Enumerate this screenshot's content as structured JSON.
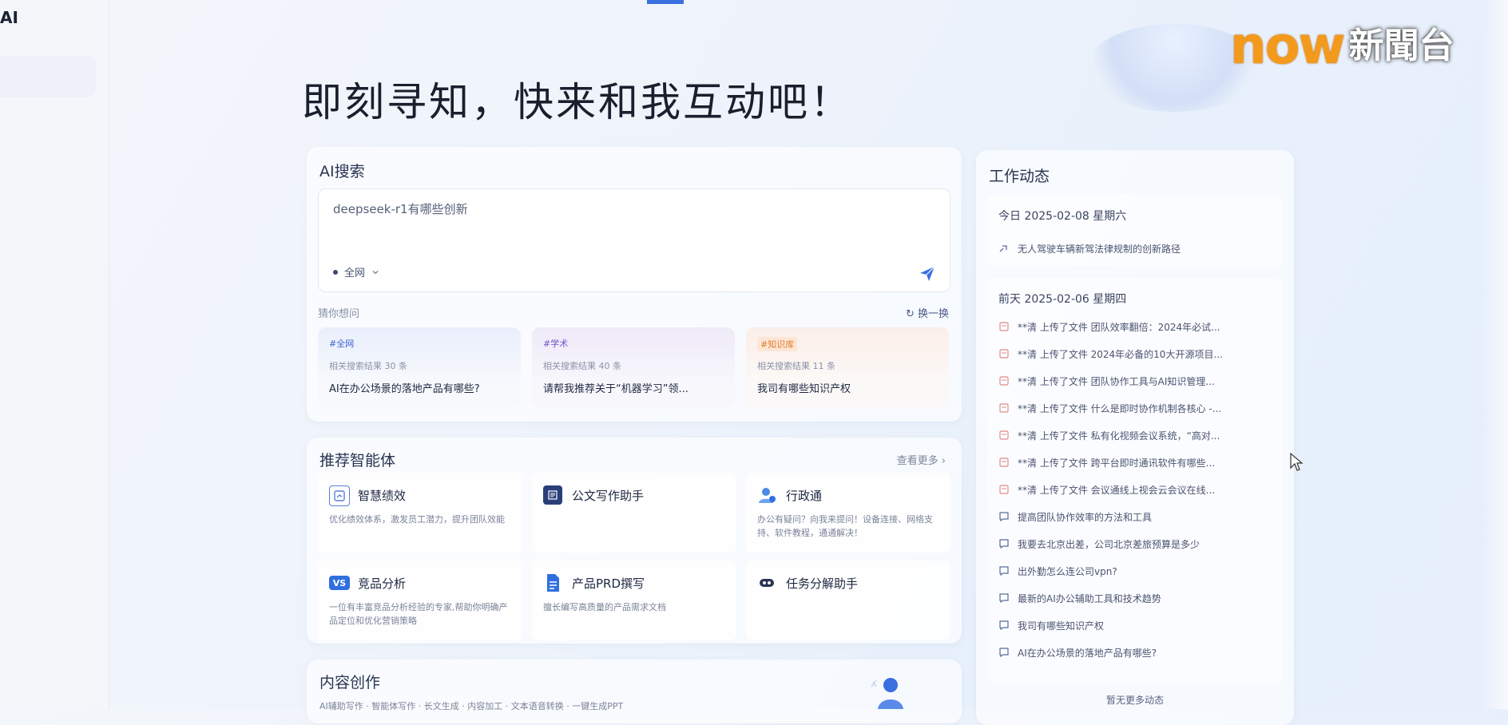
{
  "sidebar": {
    "brand": "AI"
  },
  "watermark": {
    "brand": "now",
    "name": "新聞台"
  },
  "hero": {
    "title": "即刻寻知，快来和我互动吧！"
  },
  "ai_search": {
    "title": "AI搜索",
    "query": "deepseek-r1有哪些创新",
    "scope": "全网",
    "ask_label": "猜你想问",
    "refresh_label": "换一换",
    "cards": [
      {
        "tag": "#全网",
        "count": "相关搜索结果 30 条",
        "title": "AI在办公场景的落地产品有哪些?"
      },
      {
        "tag": "#学术",
        "count": "相关搜索结果 40 条",
        "title": "请帮我推荐关于“机器学习”领..."
      },
      {
        "tag": "#知识库",
        "count": "相关搜索结果 11 条",
        "title": "我司有哪些知识产权"
      }
    ]
  },
  "agents": {
    "title": "推荐智能体",
    "more_label": "查看更多 ›",
    "items": [
      {
        "name": "智慧绩效",
        "desc": "优化绩效体系，激发员工潜力，提升团队效能",
        "icon": "performance-icon",
        "color": "#5a7fd8"
      },
      {
        "name": "公文写作助手",
        "desc": "",
        "icon": "document-writing-icon",
        "color": "#2a3f7a"
      },
      {
        "name": "行政通",
        "desc": "办公有疑问？向我来提问！设备连接、网络支持、软件教程，通通解决！",
        "icon": "admin-person-icon",
        "color": "#4a8be6"
      },
      {
        "name": "竞品分析",
        "desc": "一位有丰富竞品分析经验的专家,帮助你明确产品定位和优化营销策略",
        "icon": "vs-icon",
        "color": "#2f6fe0"
      },
      {
        "name": "产品PRD撰写",
        "desc": "擅长编写高质量的产品需求文档",
        "icon": "prd-doc-icon",
        "color": "#2f6fe0"
      },
      {
        "name": "任务分解助手",
        "desc": "",
        "icon": "task-split-icon",
        "color": "#2a3350"
      }
    ]
  },
  "content": {
    "title": "内容创作",
    "subtitle": "AI辅助写作  ·  智能体写作  ·  长文生成  ·  内容加工  ·  文本语音转换  ·  一键生成PPT"
  },
  "feed": {
    "title": "工作动态",
    "today": {
      "label": "今日 2025-02-08 星期六",
      "items": [
        {
          "icon": "link-icon",
          "text": "无人驾驶车辆新驾法律规制的创新路径"
        }
      ]
    },
    "earlier": {
      "label": "前天 2025-02-06 星期四",
      "items": [
        {
          "icon": "file-icon",
          "text": "**清 上传了文件 团队效率翻倍：2024年必试..."
        },
        {
          "icon": "file-icon",
          "text": "**清 上传了文件 2024年必备的10大开源项目..."
        },
        {
          "icon": "file-icon",
          "text": "**清 上传了文件 团队协作工具与AI知识管理..."
        },
        {
          "icon": "file-icon",
          "text": "**清 上传了文件 什么是即时协作机制各核心 -..."
        },
        {
          "icon": "file-icon",
          "text": "**清 上传了文件 私有化视频会议系统，“高对..."
        },
        {
          "icon": "file-icon",
          "text": "**清 上传了文件 跨平台即时通讯软件有哪些..."
        },
        {
          "icon": "file-icon",
          "text": "**清 上传了文件 会议通线上视会云会议在线..."
        },
        {
          "icon": "chat-icon",
          "text": "提高团队协作效率的方法和工具"
        },
        {
          "icon": "chat-icon",
          "text": "我要去北京出差，公司北京差旅预算是多少"
        },
        {
          "icon": "chat-icon",
          "text": "出外勤怎么连公司vpn?"
        },
        {
          "icon": "chat-icon",
          "text": "最新的AI办公辅助工具和技术趋势"
        },
        {
          "icon": "chat-icon",
          "text": "我司有哪些知识产权"
        },
        {
          "icon": "chat-icon",
          "text": "AI在办公场景的落地产品有哪些?"
        }
      ]
    },
    "end_label": "暂无更多动态"
  }
}
